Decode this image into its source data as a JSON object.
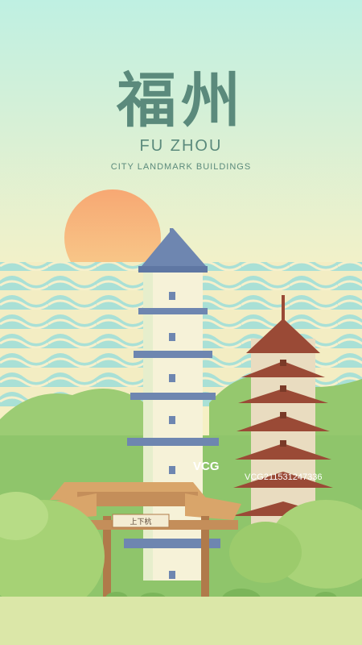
{
  "poster": {
    "title_cn": "福州",
    "title_en": "FU ZHOU",
    "subtitle": "CITY LANDMARK BUILDINGS",
    "gate_plaque": "上下杭"
  },
  "watermark": {
    "brand": "VCG",
    "id": "VCG211531247336"
  },
  "colors": {
    "sky_top": "#bfeee0",
    "sky_bottom": "#f7f0c4",
    "sun": "#f6b880",
    "title": "#5b8a7c",
    "roof_blue": "#6e86b0",
    "roof_brown": "#9a4a36",
    "gate_roof": "#d9a56a",
    "hill_green": "#8cc46a"
  }
}
